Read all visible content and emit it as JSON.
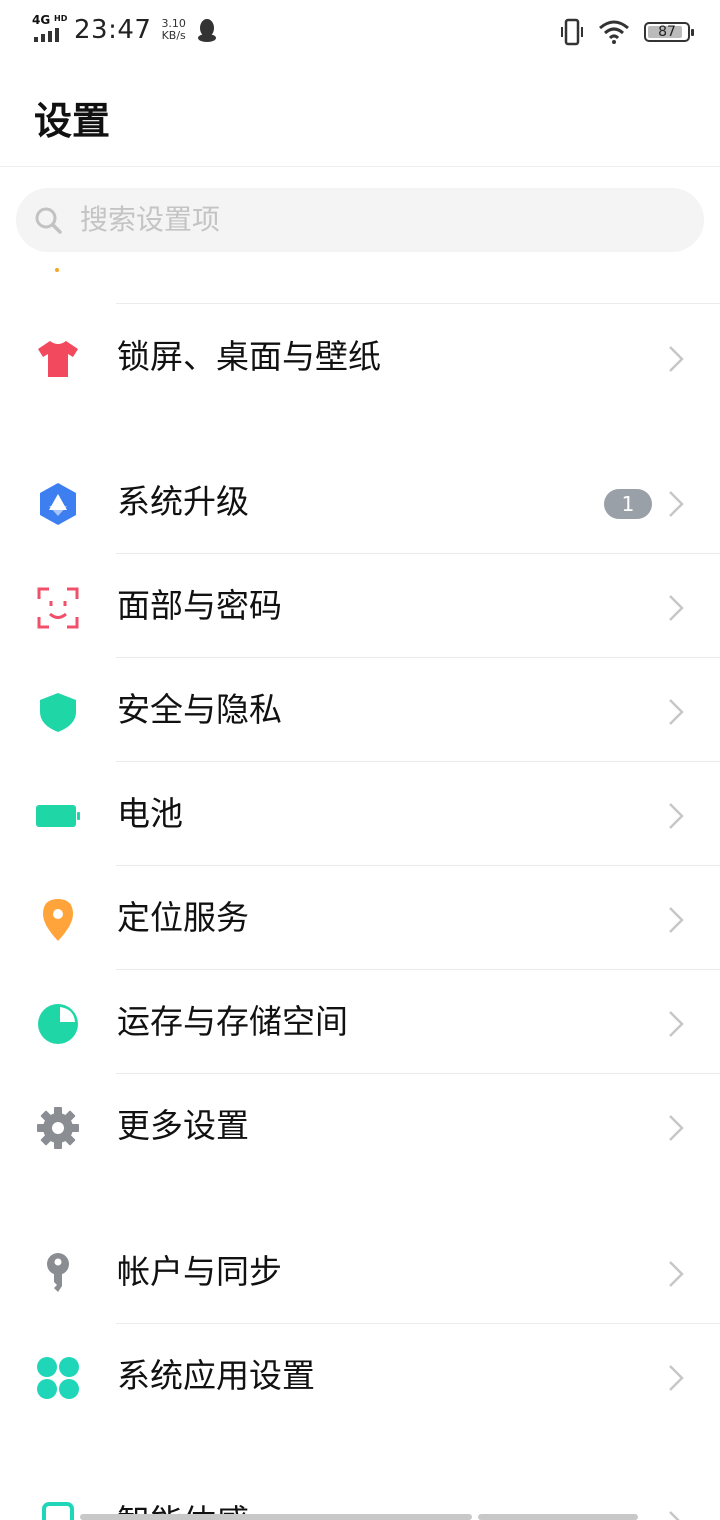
{
  "status_bar": {
    "network": "4G",
    "network_suffix": "HD",
    "time": "23:47",
    "speed_value": "3.10",
    "speed_unit": "KB/s",
    "battery_level": "87",
    "icons": [
      "signal-icon",
      "qq-penguin-icon",
      "vibrate-icon",
      "wifi-icon",
      "battery-icon"
    ]
  },
  "header": {
    "title": "设置"
  },
  "search": {
    "placeholder": "搜索设置项"
  },
  "items": [
    {
      "label": "锁屏、桌面与壁纸",
      "icon": "tshirt-icon",
      "color": "#f2495f"
    },
    {
      "label": "系统升级",
      "icon": "system-upgrade-icon",
      "color": "#3d7ff0",
      "badge": "1"
    },
    {
      "label": "面部与密码",
      "icon": "face-scan-icon",
      "color": "#f0506a"
    },
    {
      "label": "安全与隐私",
      "icon": "shield-icon",
      "color": "#1fd6a6"
    },
    {
      "label": "电池",
      "icon": "battery-icon",
      "color": "#1fd6a6"
    },
    {
      "label": "定位服务",
      "icon": "location-pin-icon",
      "color": "#ffa43a"
    },
    {
      "label": "运存与存储空间",
      "icon": "pie-chart-icon",
      "color": "#1fd6a6"
    },
    {
      "label": "更多设置",
      "icon": "gear-icon",
      "color": "#8a8d92"
    },
    {
      "label": "帐户与同步",
      "icon": "key-icon",
      "color": "#8a8d92"
    },
    {
      "label": "系统应用设置",
      "icon": "four-petal-icon",
      "color": "#1fd6b9"
    },
    {
      "label": "智能体感",
      "icon": "smart-motion-icon",
      "color": "#1fd6b9"
    }
  ]
}
